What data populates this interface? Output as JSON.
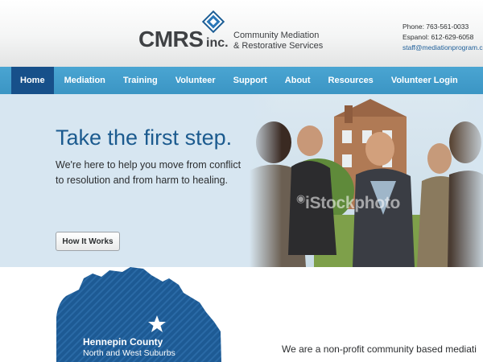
{
  "brand": {
    "logo_word": "CMRS",
    "logo_inc": "inc.",
    "tagline_line1": "Community Mediation",
    "tagline_line2": "& Restorative Services"
  },
  "contact": {
    "phone": "Phone: 763-561-0033",
    "espanol": "Espanol: 612-629-6058",
    "email": "staff@mediationprogram.c"
  },
  "nav": {
    "items": [
      {
        "label": "Home",
        "active": true
      },
      {
        "label": "Mediation"
      },
      {
        "label": "Training"
      },
      {
        "label": "Volunteer"
      },
      {
        "label": "Support"
      },
      {
        "label": "About"
      },
      {
        "label": "Resources"
      },
      {
        "label": "Volunteer Login"
      }
    ]
  },
  "hero": {
    "title": "Take the first step.",
    "subtitle": "We're here to help you move from conflict to resolution and from harm to healing.",
    "button_label": "How It Works",
    "watermark": "iStockphoto"
  },
  "map": {
    "title": "Hennepin County",
    "subtitle": "North and West Suburbs",
    "icon": "star-icon"
  },
  "intro": {
    "text": "We are a non-profit community based mediati"
  },
  "colors": {
    "nav_bg": "#3b95c4",
    "nav_active": "#17508a",
    "hero_bg": "#d7e6f1",
    "title_blue": "#1c5b8f",
    "map_blue": "#1d5a94"
  }
}
